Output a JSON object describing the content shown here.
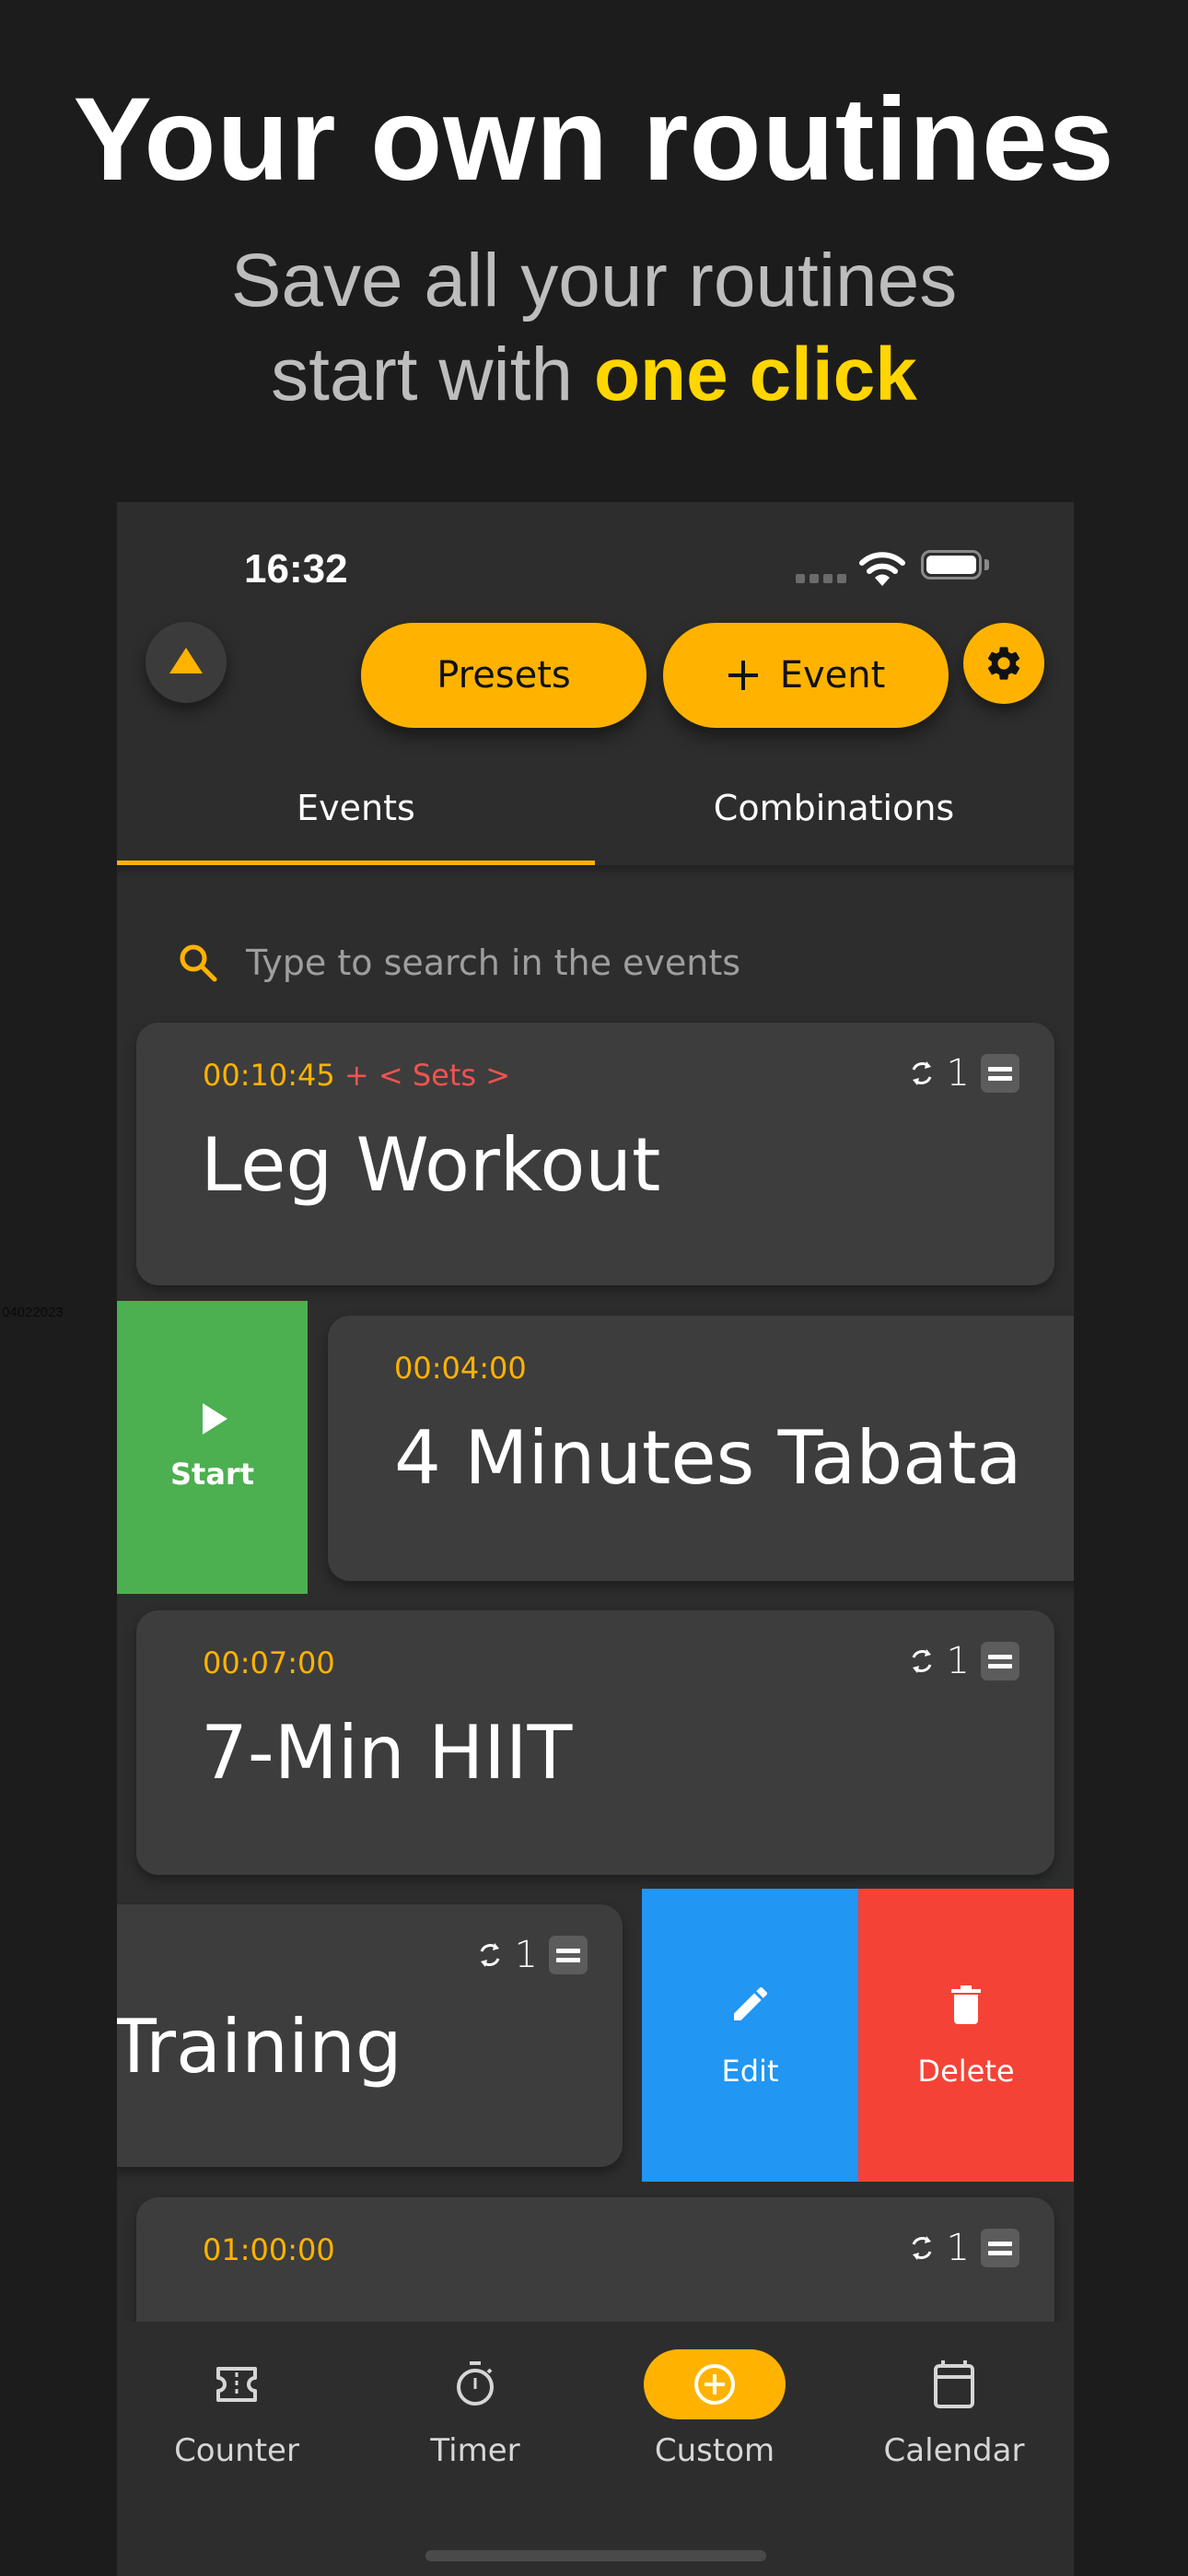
{
  "promo": {
    "headline": "Your own routines",
    "subtitle_line1": "Save all your routines",
    "subtitle_line2_prefix": "start with ",
    "subtitle_line2_accent": "one click",
    "corner_stamp": "04022023"
  },
  "colors": {
    "accent": "#ffb300",
    "promo_accent": "#ffd600",
    "start": "#4caf50",
    "edit": "#2196f3",
    "delete": "#f44336",
    "sets": "#ef5350",
    "background": "#2d2d2d",
    "card": "#3d3d3d"
  },
  "status_bar": {
    "time": "16:32",
    "icons": [
      "signal-dots-icon",
      "wifi-icon",
      "battery-icon"
    ]
  },
  "header": {
    "collapse_icon": "triangle-up-icon",
    "presets_label": "Presets",
    "add_event_label": "Event",
    "add_event_icon": "plus-icon",
    "settings_icon": "gear-icon"
  },
  "tabs": [
    {
      "label": "Events",
      "active": true
    },
    {
      "label": "Combinations",
      "active": false
    }
  ],
  "search": {
    "placeholder": "Type to search in the events",
    "value": "",
    "icon": "search-icon"
  },
  "events": [
    {
      "time": "00:10:45",
      "extra": " + < Sets >",
      "title": "Leg Workout",
      "repeat_count": "1"
    },
    {
      "time": "00:04:00",
      "title": "4 Minutes Tabata"
    },
    {
      "time": "00:07:00",
      "title": "7-Min HIIT",
      "repeat_count": "1"
    },
    {
      "title": "Training",
      "repeat_count": "1"
    },
    {
      "time": "01:00:00",
      "repeat_count": "1"
    }
  ],
  "swipe_actions": {
    "start_label": "Start",
    "edit_label": "Edit",
    "delete_label": "Delete"
  },
  "bottom_nav": [
    {
      "label": "Counter",
      "icon": "ticket-icon",
      "active": false
    },
    {
      "label": "Timer",
      "icon": "stopwatch-icon",
      "active": false
    },
    {
      "label": "Custom",
      "icon": "add-circle-icon",
      "active": true
    },
    {
      "label": "Calendar",
      "icon": "calendar-icon",
      "active": false
    }
  ]
}
